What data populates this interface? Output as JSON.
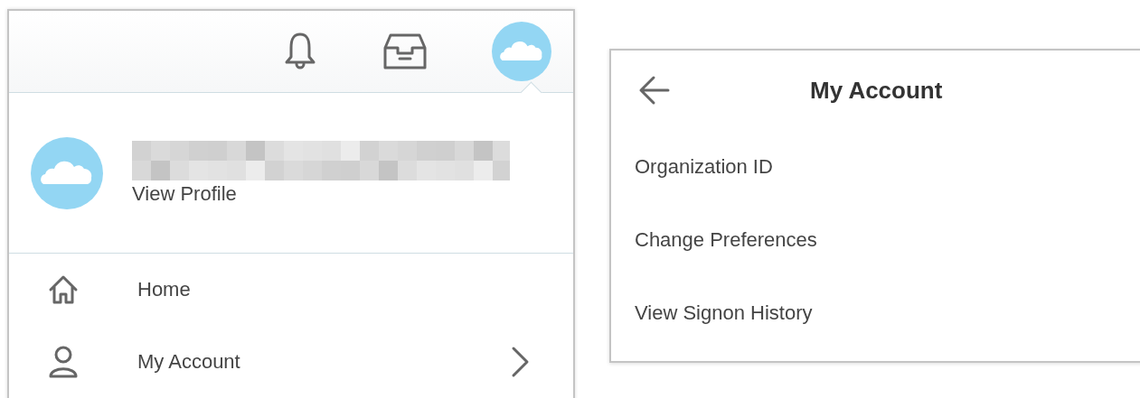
{
  "profile_menu": {
    "profile": {
      "link": "View Profile"
    },
    "items": [
      {
        "label": "Home",
        "kind": "link"
      },
      {
        "label": "My Account",
        "kind": "submenu"
      }
    ]
  },
  "account_panel": {
    "title": "My Account",
    "items": [
      "Organization ID",
      "Change Preferences",
      "View Signon History"
    ]
  }
}
